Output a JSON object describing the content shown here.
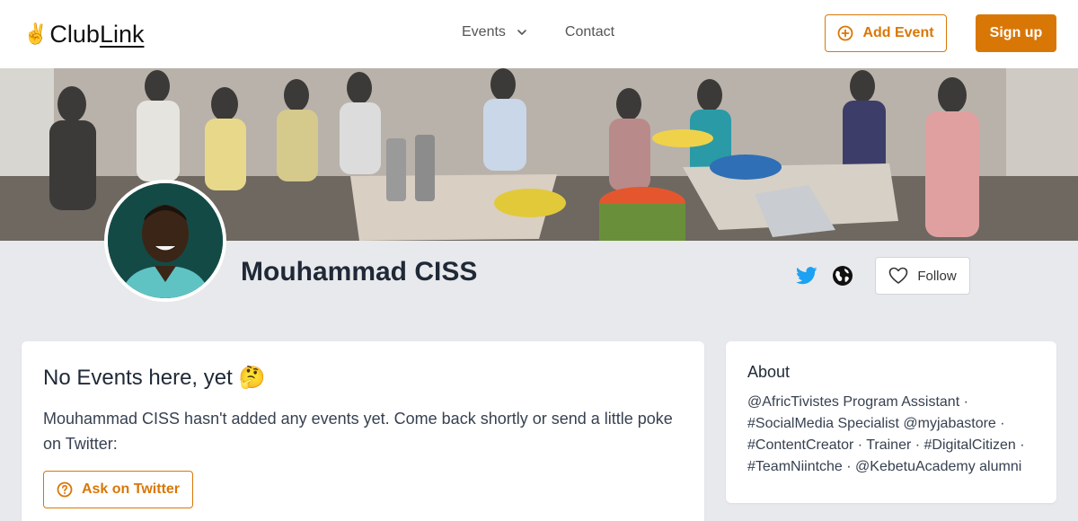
{
  "header": {
    "logo_text": "Club",
    "logo_link": "Link",
    "logo_emoji": "✌️",
    "nav_events": "Events",
    "nav_contact": "Contact",
    "add_event_label": "Add Event",
    "sign_up_label": "Sign up"
  },
  "profile": {
    "name": "Mouhammad CISS",
    "follow_label": "Follow"
  },
  "events_card": {
    "title": "No Events here, yet 🤔",
    "message": "Mouhammad CISS hasn't added any events yet. Come back shortly or send a little poke on Twitter:",
    "ask_label": "Ask on Twitter"
  },
  "about_card": {
    "title": "About",
    "bio": "@AfricTivistes Program Assistant · #SocialMedia Specialist @myjabastore · #ContentCreator · Trainer · #DigitalCitizen · #TeamNiintche · @KebetuAcademy alumni"
  },
  "colors": {
    "accent": "#d97706",
    "twitter": "#1da1f2",
    "background": "#e8e9ec"
  },
  "icons": [
    "chevron-down-icon",
    "plus-circle-icon",
    "twitter-icon",
    "globe-icon",
    "heart-icon",
    "help-circle-icon"
  ]
}
